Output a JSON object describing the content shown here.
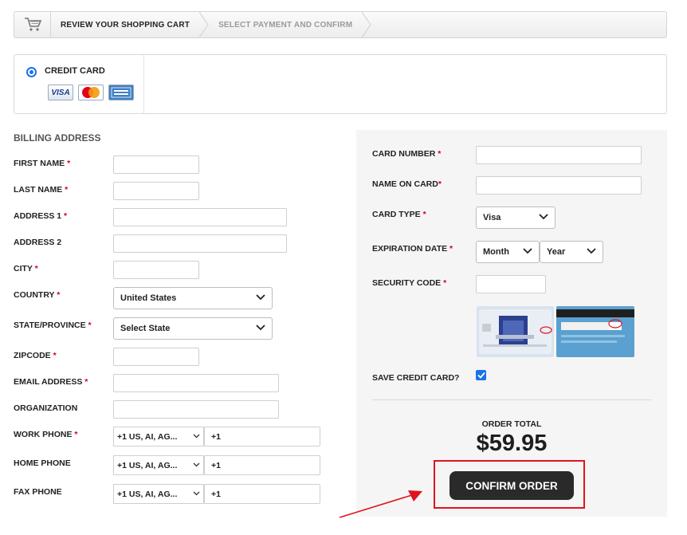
{
  "breadcrumb": {
    "step1": "REVIEW YOUR SHOPPING CART",
    "step2": "SELECT PAYMENT AND CONFIRM"
  },
  "payment_method": {
    "label": "CREDIT CARD",
    "visa": "VISA"
  },
  "billing": {
    "title": "BILLING ADDRESS",
    "first_name": "FIRST NAME",
    "last_name": "LAST NAME",
    "address1": "ADDRESS 1",
    "address2": "ADDRESS 2",
    "city": "CITY",
    "country": "COUNTRY",
    "country_value": "United States",
    "state": "STATE/PROVINCE",
    "state_value": "Select State",
    "zipcode": "ZIPCODE",
    "email": "EMAIL ADDRESS",
    "organization": "ORGANIZATION",
    "work_phone": "WORK PHONE",
    "home_phone": "HOME PHONE",
    "fax_phone": "FAX PHONE",
    "phone_country": "+1 US, AI, AG...",
    "phone_prefix": "+1",
    "required_mark": "*"
  },
  "card": {
    "card_number": "CARD NUMBER",
    "name_on_card": "NAME ON CARD",
    "card_type": "CARD TYPE",
    "card_type_value": "Visa",
    "expiration": "EXPIRATION DATE",
    "month": "Month",
    "year": "Year",
    "security_code": "SECURITY CODE",
    "save_card": "SAVE CREDIT CARD?",
    "save_card_checked": true
  },
  "order": {
    "total_label": "ORDER TOTAL",
    "total_value": "$59.95",
    "confirm_label": "CONFIRM ORDER"
  },
  "colors": {
    "accent": "#1a73e8",
    "required": "#d0021b",
    "highlight": "#e0141e",
    "button": "#2a2a2a"
  }
}
